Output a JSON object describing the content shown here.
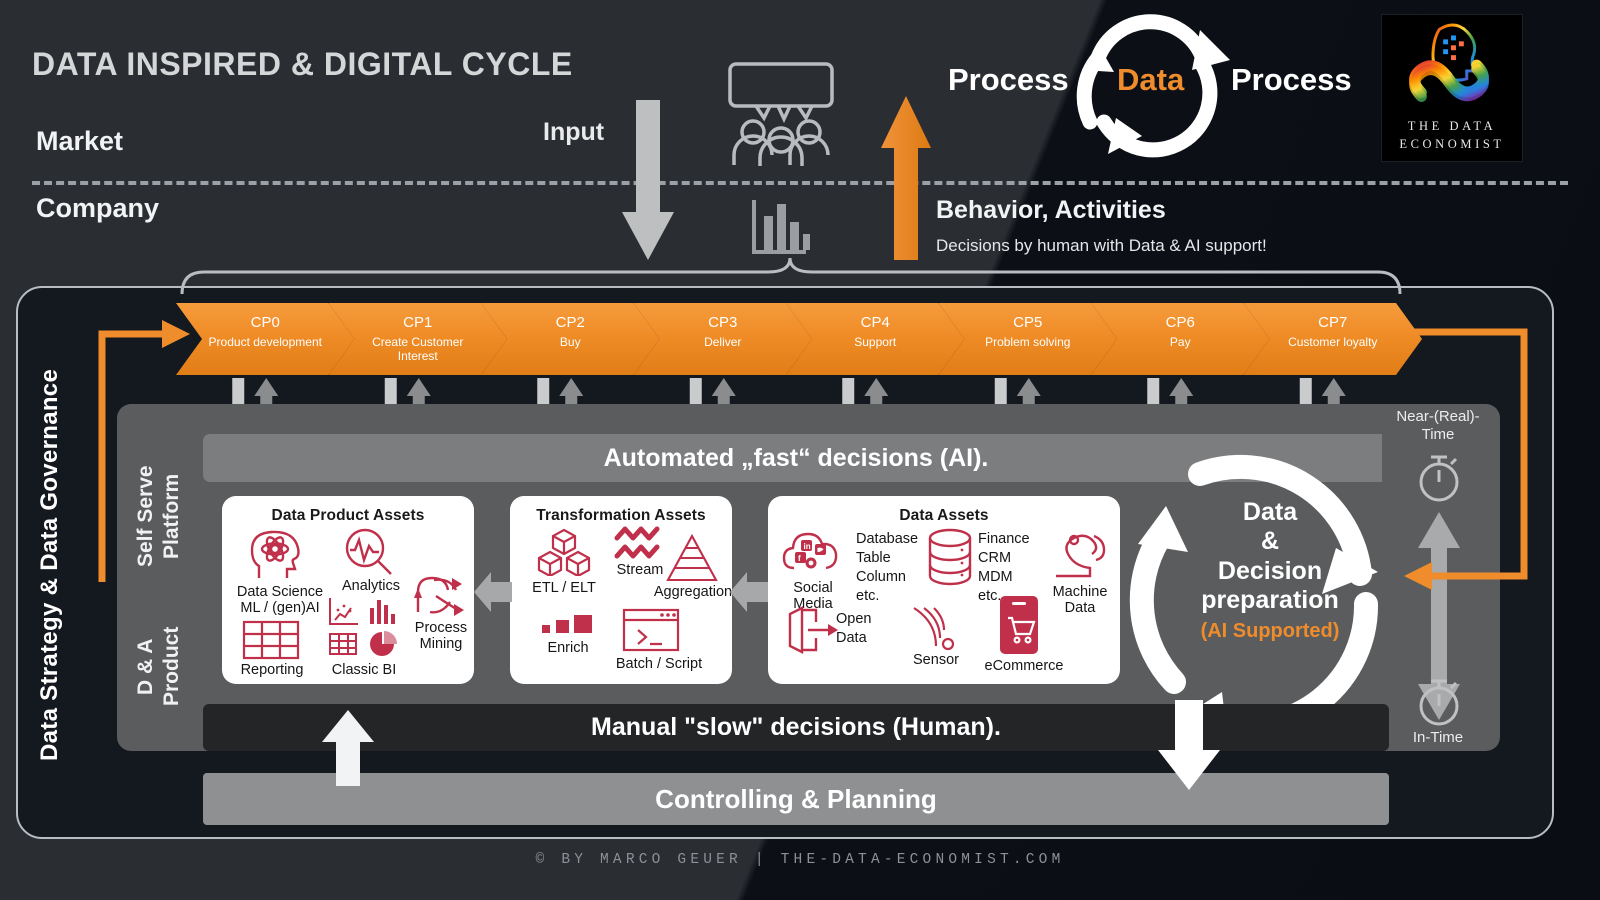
{
  "header": {
    "title": "DATA INSPIRED & DIGITAL CYCLE",
    "market_label": "Market",
    "company_label": "Company",
    "input_label": "Input",
    "behavior_title": "Behavior, Activities",
    "behavior_sub": "Decisions by human with Data & AI support!",
    "cycle": {
      "left": "Process",
      "middle": "Data",
      "right": "Process"
    },
    "icons": {
      "speech_people": "speech-bubble-people-icon",
      "bar_chart": "bar-chart-icon",
      "input_arrow": "down-arrow-icon",
      "behavior_arrow": "up-arrow-icon"
    }
  },
  "logo": {
    "line1": "THE DATA",
    "line2": "ECONOMIST",
    "art": "ai-head-infinity-icon"
  },
  "governance": {
    "label": "Data Strategy & Data Governance"
  },
  "cp_row": [
    {
      "id": "CP0",
      "sub": "Product development"
    },
    {
      "id": "CP1",
      "sub": "Create Customer Interest"
    },
    {
      "id": "CP2",
      "sub": "Buy"
    },
    {
      "id": "CP3",
      "sub": "Deliver"
    },
    {
      "id": "CP4",
      "sub": "Support"
    },
    {
      "id": "CP5",
      "sub": "Problem solving"
    },
    {
      "id": "CP6",
      "sub": "Pay"
    },
    {
      "id": "CP7",
      "sub": "Customer loyalty"
    }
  ],
  "platform": {
    "label": "D & A Product\nSelf Serve Platform",
    "automated_bar": "Automated „fast“ decisions (AI).",
    "manual_bar": "Manual \"slow\" decisions (Human).",
    "controlling_bar": "Controlling & Planning"
  },
  "cards": {
    "data_product_assets": {
      "title": "Data Product Assets",
      "items": [
        {
          "label": "Data Science\nML / (gen)AI",
          "icon": "brain-head-atom-icon"
        },
        {
          "label": "Analytics",
          "icon": "magnifier-pulse-icon"
        },
        {
          "label": "Process\nMining",
          "icon": "process-arrows-icon"
        },
        {
          "label": "Reporting",
          "icon": "table-grid-icon"
        },
        {
          "label": "Classic BI",
          "icon": "charts-scatter-bar-pie-icon"
        }
      ]
    },
    "transformation_assets": {
      "title": "Transformation Assets",
      "items": [
        {
          "label": "ETL / ELT",
          "icon": "stacked-cubes-icon"
        },
        {
          "label": "Stream",
          "icon": "zigzag-waves-icon"
        },
        {
          "label": "Aggregation",
          "icon": "layered-pyramid-icon"
        },
        {
          "label": "Enrich",
          "icon": "growing-squares-icon"
        },
        {
          "label": "Batch / Script",
          "icon": "terminal-window-icon"
        }
      ]
    },
    "data_assets": {
      "title": "Data Assets",
      "items": [
        {
          "label": "Social\nMedia",
          "icon": "cloud-social-icon"
        },
        {
          "label": "Database\nTable\nColumn\netc.",
          "icon": "database-cylinder-icon"
        },
        {
          "label": "Finance\nCRM\nMDM\netc.",
          "icon": "text-only"
        },
        {
          "label": "Machine\nData",
          "icon": "robot-arm-icon"
        },
        {
          "label": "Open\nData",
          "icon": "open-door-arrow-icon"
        },
        {
          "label": "Sensor",
          "icon": "sensor-waves-icon"
        },
        {
          "label": "eCommerce",
          "icon": "mobile-cart-icon"
        }
      ]
    }
  },
  "decision": {
    "line1": "Data",
    "line2": "&",
    "line3": "Decision",
    "line4": "preparation",
    "ai": "(AI Supported)"
  },
  "time": {
    "top": "Near-(Real)-Time",
    "bottom": "In-Time",
    "top_icon": "stopwatch-icon",
    "bottom_icon": "stopwatch-icon",
    "scale_icon": "double-arrow-vertical-icon"
  },
  "footer": {
    "text": "© BY MARCO GEUER | THE-DATA-ECONOMIST.COM"
  },
  "colors": {
    "orange": "#ef8c2b",
    "orange_dark": "#e07d17",
    "panel_gray": "#5a5c5e",
    "bar_gray": "#7b7d7f",
    "dark_bar": "#232527",
    "red": "#c0304a",
    "bg": "#0c1016"
  }
}
